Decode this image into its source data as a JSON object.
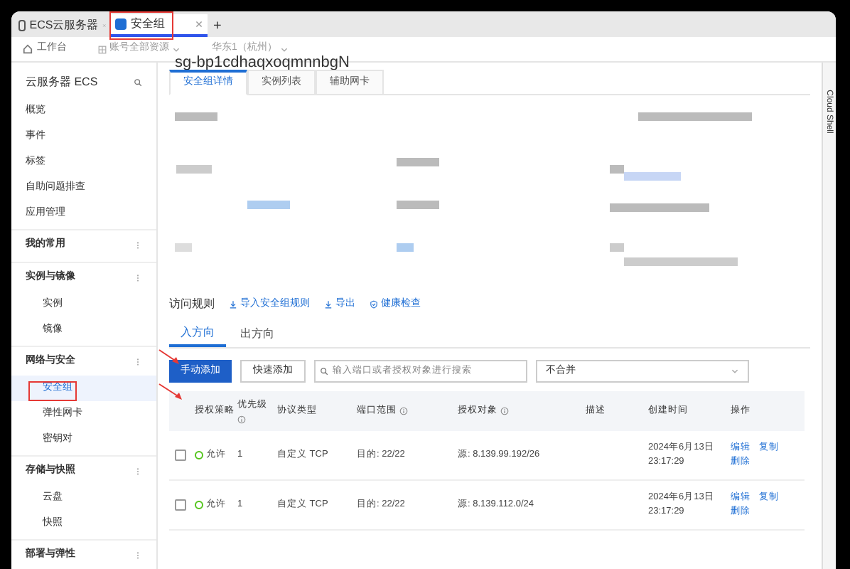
{
  "browser_tabs": [
    {
      "label": "ECS云服务器",
      "selected": false
    },
    {
      "label": "安全组",
      "selected": true
    }
  ],
  "new_tab": "+",
  "toolbar": {
    "home": "工作台",
    "resource": "账号全部资源",
    "region": "华东1（杭州）"
  },
  "page_title": "sg-bp1cdhaqxoqmnnbgN",
  "sidebar": {
    "title": "云服务器 ECS",
    "items": [
      {
        "kind": "link",
        "label": "概览",
        "selected": false
      },
      {
        "kind": "link",
        "label": "事件",
        "selected": false
      },
      {
        "kind": "link",
        "label": "标签",
        "selected": false
      },
      {
        "kind": "link",
        "label": "自助问题排查",
        "selected": false
      },
      {
        "kind": "link",
        "label": "应用管理",
        "selected": false
      },
      {
        "kind": "group",
        "label": "我的常用"
      },
      {
        "kind": "group",
        "label": "实例与镜像"
      },
      {
        "kind": "sub",
        "label": "实例",
        "selected": false
      },
      {
        "kind": "sub",
        "label": "镜像",
        "selected": false
      },
      {
        "kind": "group",
        "label": "网络与安全"
      },
      {
        "kind": "sub",
        "label": "安全组",
        "selected": true
      },
      {
        "kind": "sub",
        "label": "弹性网卡",
        "selected": false
      },
      {
        "kind": "sub",
        "label": "密钥对",
        "selected": false
      },
      {
        "kind": "group",
        "label": "存储与快照"
      },
      {
        "kind": "sub",
        "label": "云盘",
        "selected": false
      },
      {
        "kind": "sub",
        "label": "快照",
        "selected": false
      },
      {
        "kind": "group",
        "label": "部署与弹性"
      }
    ]
  },
  "detail_tabs": [
    {
      "label": "安全组详情",
      "selected": true
    },
    {
      "label": "实例列表",
      "selected": false
    },
    {
      "label": "辅助网卡",
      "selected": false
    }
  ],
  "rules": {
    "title": "访问规则",
    "actions": [
      "导入安全组规则",
      "导出",
      "健康检查"
    ],
    "direction_tabs": [
      {
        "label": "入方向",
        "selected": true
      },
      {
        "label": "出方向",
        "selected": false
      }
    ],
    "add_button": "手动添加",
    "quick_add_button": "快速添加",
    "search": {
      "placeholder": "输入端口或者授权对象进行搜索"
    },
    "merge_select": {
      "value": "不合并"
    },
    "columns": [
      "授权策略",
      "优先级",
      "协议类型",
      "端口范围",
      "授权对象",
      "描述",
      "创建时间",
      "操作"
    ],
    "rows": [
      {
        "checked": false,
        "policy": "允许",
        "priority": "1",
        "protocol": "自定义 TCP",
        "port": "目的: 22/22",
        "source": "源: 8.139.99.192/26",
        "created": [
          "2024年6月13日",
          "23:17:29"
        ],
        "actions": [
          "编辑",
          "复制",
          "删除"
        ]
      },
      {
        "checked": false,
        "policy": "允许",
        "priority": "1",
        "protocol": "自定义 TCP",
        "port": "目的: 22/22",
        "source": "源: 8.139.112.0/24",
        "created": [
          "2024年6月13日",
          "23:17:29"
        ],
        "actions": [
          "编辑",
          "复制",
          "删除"
        ]
      }
    ]
  },
  "right_rail": {
    "label": "Cloud Shell"
  }
}
